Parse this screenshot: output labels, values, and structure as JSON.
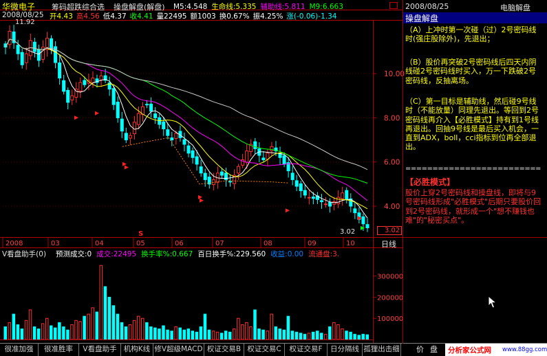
{
  "header": {
    "stock_name": "华微电子",
    "formula_name": "筹码超跌综合选",
    "chart_title": "操盘解盘(解盘)",
    "ma_items": [
      {
        "label": "M5:4.548",
        "color": "#ffffff"
      },
      {
        "label": "生命线:5.335",
        "color": "#ffff00"
      },
      {
        "label": "辅助线:5.811",
        "color": "#ff00ff"
      },
      {
        "label": "M9:6.663",
        "color": "#00ff00"
      }
    ],
    "date": "2008/08/25",
    "quotes": [
      {
        "label": "开4.43",
        "color": "#ffff00"
      },
      {
        "label": "高4.56",
        "color": "#ff3030"
      },
      {
        "label": "低4.37",
        "color": "#ffffff"
      },
      {
        "label": "收4.41",
        "color": "#00ff00"
      },
      {
        "label": "量22495",
        "color": "#ffffff"
      },
      {
        "label": "额1003",
        "color": "#ffffff"
      },
      {
        "label": "换0.67%",
        "color": "#ffffff"
      },
      {
        "label": "振4.25%",
        "color": "#ffffff"
      },
      {
        "label": "涨(-0.06)-1.34",
        "color": "#00ffff"
      }
    ]
  },
  "annotations": {
    "high_label": "11.92",
    "low_label": "3.02",
    "last_price_tag": "3.02",
    "day_line_tab": "日线"
  },
  "volume_header": {
    "indicator": "V看盘助手(0)",
    "items": [
      {
        "label": "预测成交:0",
        "color": "#ffffff"
      },
      {
        "label": "成交:22495",
        "color": "#ff00ff"
      },
      {
        "label": "换手率%:0.667",
        "color": "#00ff00"
      },
      {
        "label": "百日换手%:229.560",
        "color": "#ffffff"
      },
      {
        "label": "收益:0.00",
        "color": "#0080ff"
      },
      {
        "label": "流通盘:3.",
        "color": "#ff3030"
      }
    ]
  },
  "right_panel": {
    "date": "2008/08/25",
    "app_name": "电脑解盘",
    "section_title": "操盘解盘",
    "paragraphs": [
      "（A）上冲时第一次碰（过）2号密码线时(强庄股除外)，先退出；",
      "（B）股价再突破2号密码线后四天内阴线碰2号密码线时买入，万一下跌破2号密码线，反抽离场。",
      "（C）第一目标是辅助线，然后碰9号线时（不能放量）同理先退出。等回到2号密码线再介入【必胜模式】持有到1号线再退出。回抽9号线是最后买入机会，一直到ADX，boll，cci指标到位再全部退出。"
    ],
    "separator": "==============================",
    "pattern_title": "【必胜模式】",
    "pattern_text": "股价上穿2号密码线和操盘线，即将与9号密码线形成\"必胜模式\"后期只要股价回到2号密码线，就形成一个\"想不赚钱也难\"的\"秘密买点\"。"
  },
  "tabs": [
    "很准加强",
    "很准胜率",
    "V看盘助手",
    "机构K线",
    "修V超级MACD",
    "权证交易B",
    "权证交易C",
    "权证交易F",
    "日分隔线",
    "孤狸出击细"
  ],
  "tab_buttons": [
    "价",
    "盘"
  ],
  "brand": {
    "name": "分析家公式网",
    "url": "www.88gg.com"
  },
  "colors": {
    "up": "#ff3030",
    "down": "#00ffff",
    "axis": "#b00000",
    "grid": "#5a0000"
  },
  "chart_data": {
    "type": "candlestick",
    "price_axis": {
      "ticks": [
        4.0,
        6.0,
        8.0,
        10.0
      ],
      "range": [
        2.6,
        12.4
      ]
    },
    "volume_axis": {
      "ticks": [
        100000,
        200000,
        300000
      ],
      "range": [
        0,
        380000
      ]
    },
    "month_labels": [
      "2008",
      "03",
      "04",
      "05",
      "06",
      "07",
      "08",
      "09",
      "10"
    ],
    "close_path": [
      11.2,
      11.92,
      11.4,
      10.9,
      10.4,
      10.9,
      11.5,
      11.0,
      10.6,
      11.2,
      11.6,
      11.1,
      10.5,
      9.8,
      9.2,
      8.7,
      9.0,
      9.3,
      9.6,
      9.5,
      9.7,
      9.8,
      9.6,
      9.9,
      9.7,
      9.3,
      8.6,
      8.0,
      7.4,
      7.0,
      7.2,
      7.8,
      8.2,
      8.5,
      8.6,
      8.3,
      8.0,
      7.7,
      7.5,
      7.2,
      7.0,
      7.3,
      7.1,
      6.8,
      6.4,
      6.2,
      5.9,
      5.5,
      5.2,
      5.0,
      5.2,
      5.5,
      5.4,
      5.2,
      5.1,
      5.4,
      5.8,
      6.1,
      6.5,
      6.8,
      6.6,
      6.3,
      6.1,
      6.4,
      6.7,
      6.5,
      6.2,
      5.9,
      5.6,
      5.2,
      4.9,
      4.7,
      4.5,
      4.4,
      4.35,
      4.3,
      4.2,
      4.1,
      4.0,
      4.2,
      4.4,
      4.6,
      4.3,
      4.0,
      3.7,
      3.4,
      3.2,
      3.02
    ],
    "volume": [
      60000,
      80000,
      120000,
      70000,
      50000,
      90000,
      140000,
      60000,
      50000,
      75000,
      100000,
      65000,
      55000,
      80000,
      60000,
      45000,
      70000,
      90000,
      85000,
      110000,
      120000,
      150000,
      130000,
      350000,
      250000,
      200000,
      160000,
      120000,
      80000,
      60000,
      70000,
      90000,
      110000,
      100000,
      80000,
      60000,
      55000,
      50000,
      65000,
      45000,
      40000,
      60000,
      55000,
      45000,
      50000,
      40000,
      35000,
      60000,
      120000,
      45000,
      40000,
      35000,
      30000,
      40000,
      35000,
      50000,
      100000,
      70000,
      80000,
      60000,
      140000,
      50000,
      45000,
      40000,
      120000,
      60000,
      50000,
      45000,
      110000,
      40000,
      35000,
      30000,
      25000,
      30000,
      35000,
      40000,
      30000,
      25000,
      60000,
      80000,
      70000,
      50000,
      40000,
      35000,
      25000,
      20000,
      25000,
      22495
    ]
  }
}
